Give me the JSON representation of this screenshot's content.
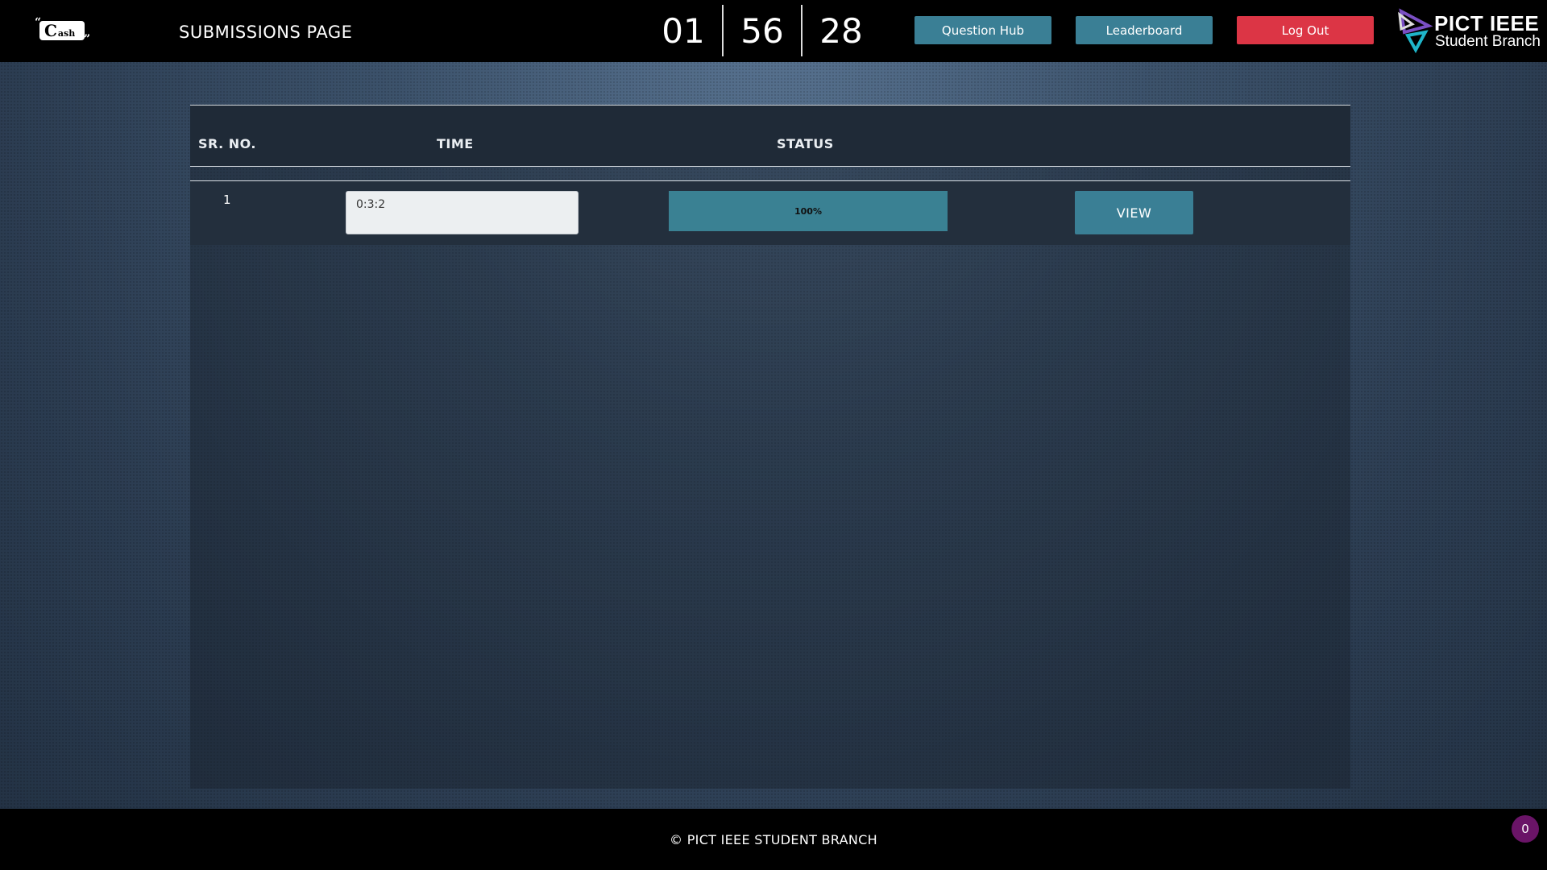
{
  "header": {
    "logo_text": "Clash",
    "page_title": "SUBMISSIONS PAGE",
    "timer": {
      "hours": "01",
      "minutes": "56",
      "seconds": "28"
    },
    "buttons": {
      "question_hub": "Question Hub",
      "leaderboard": "Leaderboard",
      "logout": "Log Out"
    },
    "org_logo": {
      "line1": "PICT IEEE",
      "line2": "Student Branch"
    }
  },
  "table": {
    "headers": {
      "sr_no": "SR. NO.",
      "time": "TIME",
      "status": "STATUS"
    },
    "rows": [
      {
        "sr_no": "1",
        "time": "0:3:2",
        "status_label": "100%",
        "status_percent": 100,
        "action": "VIEW"
      }
    ]
  },
  "footer": {
    "text": "© PICT IEEE STUDENT BRANCH"
  },
  "badge": {
    "count": "0"
  },
  "colors": {
    "primary_button": "#3a7f95",
    "logout_button": "#dc3545",
    "badge": "#6a1467",
    "header_bg": "#000000"
  }
}
